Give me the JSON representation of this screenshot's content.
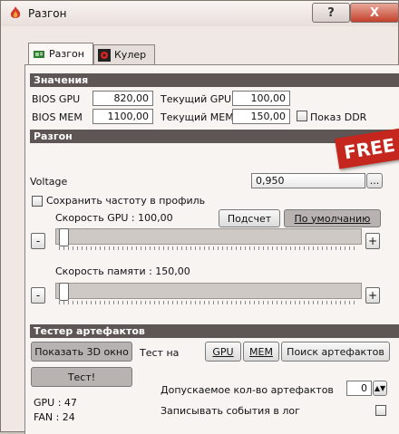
{
  "window": {
    "title": "Разгон",
    "help_label": "?",
    "close_label": "X",
    "icon": "flame-app-icon"
  },
  "tabs": [
    {
      "label": "Разгон",
      "icon": "gpu-card-icon",
      "active": true
    },
    {
      "label": "Кулер",
      "icon": "fan-cooler-icon",
      "active": false
    }
  ],
  "values_section": {
    "header": "Значения",
    "bios_gpu_label": "BIOS GPU",
    "bios_gpu_value": "820,00",
    "bios_mem_label": "BIOS MEM",
    "bios_mem_value": "1100,00",
    "current_gpu_label": "Текущий GPU",
    "current_gpu_value": "100,00",
    "current_mem_label": "Текущий MEM",
    "current_mem_value": "150,00",
    "show_ddr_label": "Показ DDR"
  },
  "overclock_section": {
    "header": "Разгон",
    "voltage_label": "Voltage",
    "voltage_value": "0,950",
    "voltage_more_label": "...",
    "save_profile_label": "Сохранить частоту в профиль",
    "gpu_speed_label": "Скорость GPU : 100,00",
    "calc_button": "Подсчет",
    "default_button": "По умолчанию",
    "gpu_slider_value": 0.0,
    "mem_speed_label": "Скорость памяти : 150,00",
    "mem_slider_value": 0.0,
    "minus_label": "-",
    "plus_label": "+"
  },
  "artifact_section": {
    "header": "Тестер артефактов",
    "show_3d_button": "Показать 3D окно",
    "test_on_label": "Тест на",
    "gpu_button": "GPU",
    "mem_button": "MEM",
    "search_button": "Поиск артефактов",
    "test_button": "Тест!",
    "allowed_artifacts_label": "Допускаемое кол-во артефактов",
    "allowed_artifacts_value": "0",
    "log_events_label": "Записывать события в лог",
    "gpu_stat": "GPU : 47",
    "fan_stat": "FAN : 24"
  },
  "overlay_badge": "FREE",
  "colors": {
    "section_header_bg": "#5d5654",
    "close_button": "#c4412d",
    "badge": "#c5261d"
  }
}
